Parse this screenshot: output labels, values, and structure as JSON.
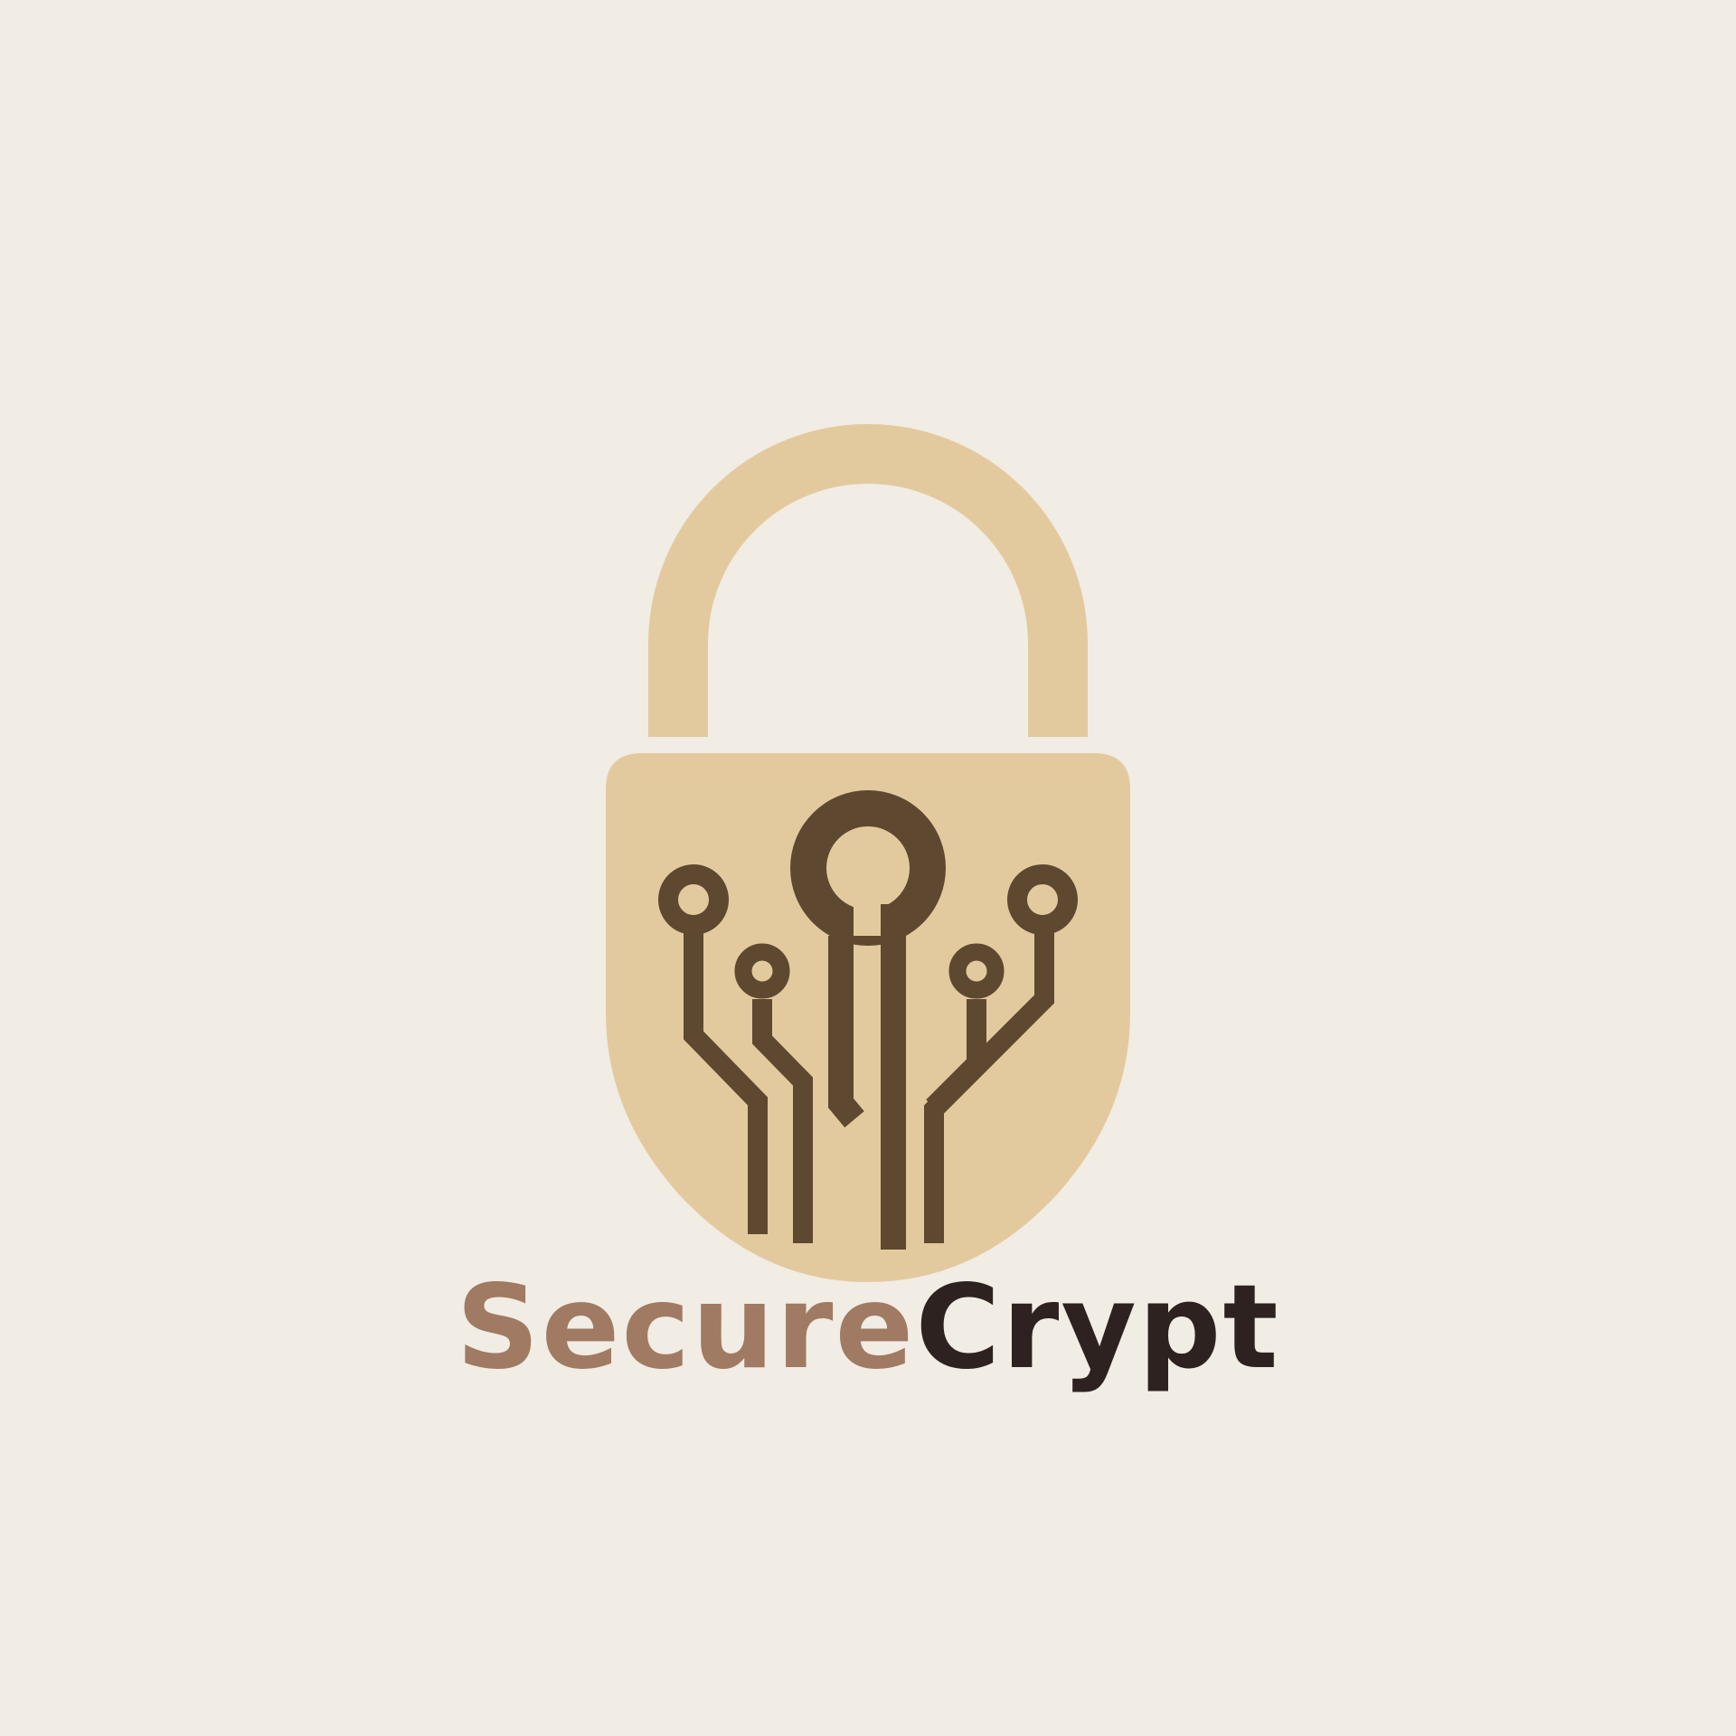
{
  "brand": {
    "name_part_1": "Secure",
    "name_part_2": "Crypt"
  },
  "colors": {
    "background": "#f1ece4",
    "lock_fill": "#e3ca9e",
    "circuit": "#5e4830",
    "name_part_1": "#a07a62",
    "name_part_2": "#2e2220"
  },
  "icons": {
    "logo": "padlock-circuit-icon"
  }
}
